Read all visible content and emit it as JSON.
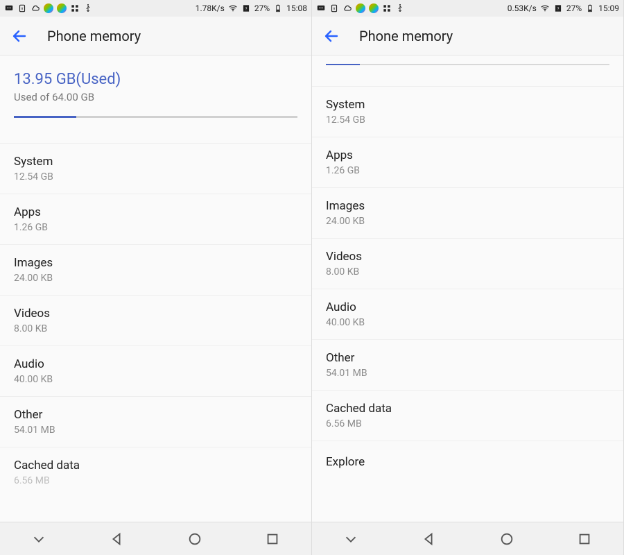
{
  "left": {
    "status": {
      "net_speed": "1.78K/s",
      "battery_pct": "27%",
      "clock": "15:08"
    },
    "app_bar": {
      "title": "Phone memory"
    },
    "usage": {
      "used_line": "13.95 GB(Used)",
      "total_line": "Used of 64.00 GB"
    },
    "items": [
      {
        "label": "System",
        "sub": "12.54 GB"
      },
      {
        "label": "Apps",
        "sub": "1.26 GB"
      },
      {
        "label": "Images",
        "sub": "24.00 KB"
      },
      {
        "label": "Videos",
        "sub": "8.00 KB"
      },
      {
        "label": "Audio",
        "sub": "40.00 KB"
      },
      {
        "label": "Other",
        "sub": "54.01 MB"
      }
    ],
    "truncated": {
      "label": "Cached data",
      "sub": "6.56 MB"
    }
  },
  "right": {
    "status": {
      "net_speed": "0.53K/s",
      "battery_pct": "27%",
      "clock": "15:09"
    },
    "app_bar": {
      "title": "Phone memory"
    },
    "items": [
      {
        "label": "System",
        "sub": "12.54 GB"
      },
      {
        "label": "Apps",
        "sub": "1.26 GB"
      },
      {
        "label": "Images",
        "sub": "24.00 KB"
      },
      {
        "label": "Videos",
        "sub": "8.00 KB"
      },
      {
        "label": "Audio",
        "sub": "40.00 KB"
      },
      {
        "label": "Other",
        "sub": "54.01 MB"
      },
      {
        "label": "Cached data",
        "sub": "6.56 MB"
      }
    ],
    "explore": {
      "label": "Explore"
    }
  }
}
